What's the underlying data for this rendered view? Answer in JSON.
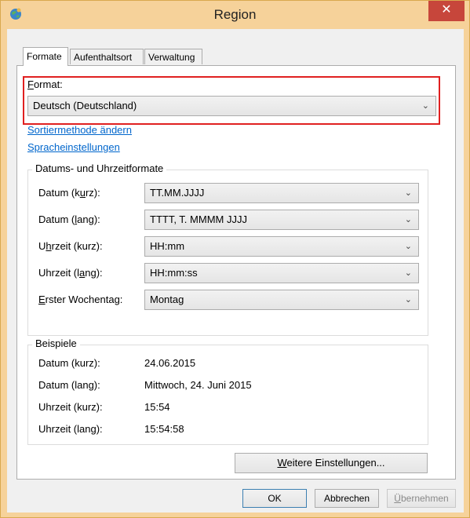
{
  "window": {
    "title": "Region",
    "close_label": "✕",
    "icon": "globe-icon",
    "frame_color": "#f6d29a"
  },
  "tabs": [
    {
      "label": "Formate",
      "active": true
    },
    {
      "label": "Aufenthaltsort",
      "active": false
    },
    {
      "label": "Verwaltung",
      "active": false
    }
  ],
  "format": {
    "label_mnemonic": "F",
    "label_rest": "ormat:",
    "selected": "Deutsch (Deutschland)",
    "highlight_color": "#e02020"
  },
  "links": {
    "sort": "Sortiermethode ändern",
    "language": "Spracheinstellungen"
  },
  "datetime": {
    "title": "Datums- und Uhrzeitformate",
    "rows": [
      {
        "label_pre": "Datum (k",
        "label_u": "u",
        "label_post": "rz):",
        "value": "TT.MM.JJJJ"
      },
      {
        "label_pre": "Datum (",
        "label_u": "l",
        "label_post": "ang):",
        "value": "TTTT, T. MMMM JJJJ"
      },
      {
        "label_pre": "U",
        "label_u": "h",
        "label_post": "rzeit (kurz):",
        "value": "HH:mm"
      },
      {
        "label_pre": "Uhrzeit (l",
        "label_u": "a",
        "label_post": "ng):",
        "value": "HH:mm:ss"
      },
      {
        "label_pre": "",
        "label_u": "E",
        "label_post": "rster Wochentag:",
        "value": "Montag"
      }
    ]
  },
  "examples": {
    "title": "Beispiele",
    "rows": [
      {
        "label": "Datum (kurz):",
        "value": "24.06.2015"
      },
      {
        "label": "Datum (lang):",
        "value": "Mittwoch, 24. Juni 2015"
      },
      {
        "label": "Uhrzeit (kurz):",
        "value": "15:54"
      },
      {
        "label": "Uhrzeit (lang):",
        "value": "15:54:58"
      }
    ]
  },
  "buttons": {
    "more_settings_u": "W",
    "more_settings_rest": "eitere Einstellungen...",
    "ok": "OK",
    "cancel": "Abbrechen",
    "apply_u": "Ü",
    "apply_rest": "bernehmen"
  }
}
